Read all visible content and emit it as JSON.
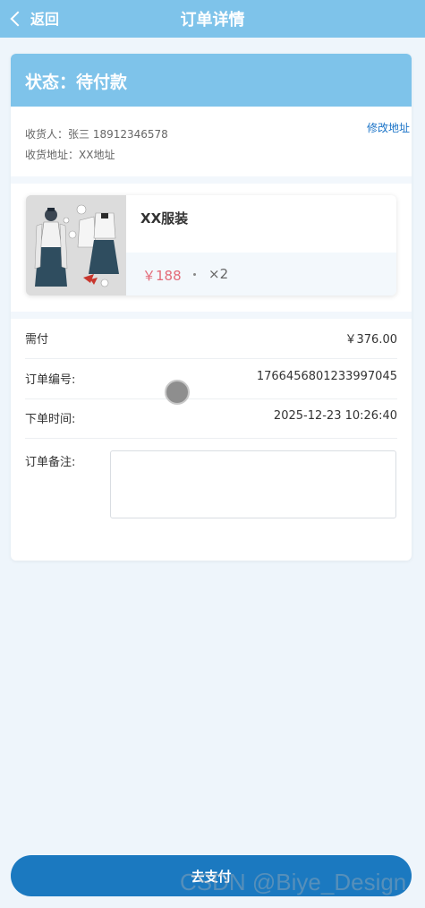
{
  "header": {
    "back_label": "返回",
    "title": "订单详情"
  },
  "status": {
    "text": "状态：待付款"
  },
  "address": {
    "recipient_line": "收货人：张三  18912346578",
    "address_line": "收货地址：XX地址",
    "edit_label": "修改地址"
  },
  "product": {
    "name": "XX服装",
    "price": "￥188",
    "quantity": "×2"
  },
  "summary": {
    "pay_label": "需付",
    "pay_value": "￥376.00",
    "order_no_label": "订单编号:",
    "order_no_value": "1766456801233997045",
    "order_time_label": "下单时间:",
    "order_time_value": "2025-12-23 10:26:40",
    "note_label": "订单备注:",
    "note_value": ""
  },
  "actions": {
    "pay_button": "去支付"
  },
  "watermark": "CSDN @Biye_Design",
  "colors": {
    "header_bg": "#7ec3ea",
    "accent_link": "#1a73c7",
    "price": "#e36a78",
    "pay_button": "#1b79c0"
  },
  "icons": {
    "back": "chevron-left-icon"
  }
}
